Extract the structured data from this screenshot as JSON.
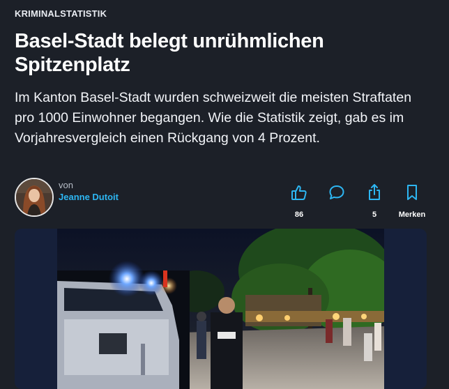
{
  "article": {
    "kicker": "KRIMINALSTATISTIK",
    "headline": "Basel-Stadt belegt unrühmlichen Spitzenplatz",
    "lead": "Im Kanton Basel-Stadt wurden schweizweit die meisten Straftaten pro 1000 Einwohner begangen. Wie die Statistik zeigt, gab es im Vorjahresvergleich einen Rückgang von 4 Prozent."
  },
  "author": {
    "by_label": "von",
    "name": "Jeanne Dutoit"
  },
  "actions": {
    "like": {
      "icon": "thumbs-up-icon",
      "count": "86"
    },
    "comment": {
      "icon": "comment-bubble-icon",
      "count": ""
    },
    "share": {
      "icon": "share-icon",
      "count": "5"
    },
    "save": {
      "icon": "bookmark-icon",
      "label": "Merken"
    }
  },
  "colors": {
    "background": "#1c2028",
    "accent": "#2db6f2",
    "media_backdrop": "#16203a"
  }
}
